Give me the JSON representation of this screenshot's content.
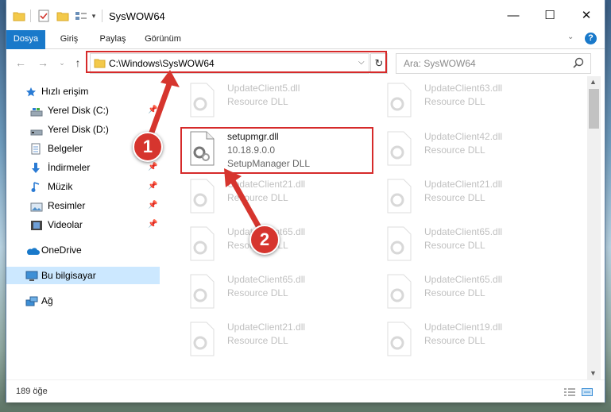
{
  "window": {
    "title": "SysWOW64",
    "minimize": "—",
    "maximize": "☐",
    "close": "✕"
  },
  "ribbon": {
    "tabs": [
      "Dosya",
      "Giriş",
      "Paylaş",
      "Görünüm"
    ]
  },
  "address": {
    "path": "C:\\Windows\\SysWOW64",
    "search_placeholder": "Ara: SysWOW64"
  },
  "nav": {
    "quick_access": "Hızlı erişim",
    "items": [
      {
        "label": "Yerel Disk (C:)",
        "icon": "drive-icon",
        "pinned": true
      },
      {
        "label": "Yerel Disk (D:)",
        "icon": "drive-icon",
        "pinned": false
      },
      {
        "label": "Belgeler",
        "icon": "documents-icon",
        "pinned": true
      },
      {
        "label": "İndirmeler",
        "icon": "downloads-icon",
        "pinned": true
      },
      {
        "label": "Müzik",
        "icon": "music-icon",
        "pinned": true
      },
      {
        "label": "Resimler",
        "icon": "pictures-icon",
        "pinned": true
      },
      {
        "label": "Videolar",
        "icon": "videos-icon",
        "pinned": true
      }
    ],
    "onedrive": "OneDrive",
    "this_pc": "Bu bilgisayar",
    "network": "Ağ"
  },
  "files": {
    "highlighted": {
      "name": "setupmgr.dll",
      "version": "10.18.9.0.0",
      "type": "SetupManager DLL"
    },
    "left_column": [
      {
        "name": "UpdateClient5.dll",
        "type": "Resource DLL"
      },
      {
        "name": "UpdateClient21.dll",
        "type": "Resource DLL"
      },
      {
        "name": "UpdateClient65.dll",
        "type": "Resource DLL"
      },
      {
        "name": "UpdateClient65.dll",
        "type": "Resource DLL"
      },
      {
        "name": "UpdateClient21.dll",
        "type": "Resource DLL"
      }
    ],
    "right_column": [
      {
        "name": "UpdateClient63.dll",
        "type": "Resource DLL"
      },
      {
        "name": "UpdateClient42.dll",
        "type": "Resource DLL"
      },
      {
        "name": "UpdateClient21.dll",
        "type": "Resource DLL"
      },
      {
        "name": "UpdateClient65.dll",
        "type": "Resource DLL"
      },
      {
        "name": "UpdateClient65.dll",
        "type": "Resource DLL"
      },
      {
        "name": "UpdateClient19.dll",
        "type": "Resource DLL"
      }
    ]
  },
  "status": {
    "count": "189 öğe"
  },
  "annotations": {
    "step1": "1",
    "step2": "2"
  },
  "colors": {
    "accent": "#1979ca",
    "highlight_box": "#d62a2a",
    "selection": "#cce8ff"
  }
}
